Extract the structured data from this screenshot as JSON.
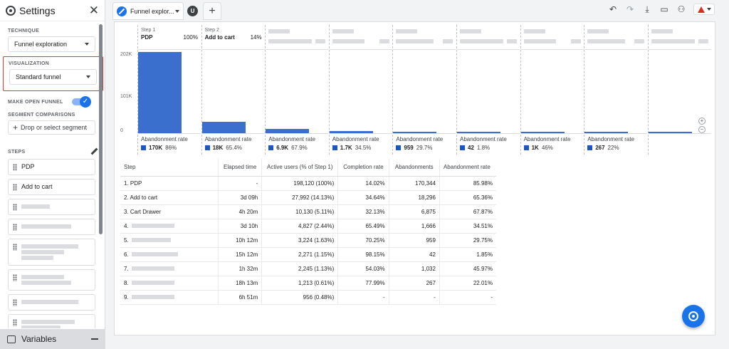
{
  "settings": {
    "title": "Settings",
    "technique_label": "TECHNIQUE",
    "technique_value": "Funnel exploration",
    "visualization_label": "VISUALIZATION",
    "visualization_value": "Standard funnel",
    "open_funnel_label": "MAKE OPEN FUNNEL",
    "open_funnel_checked": true,
    "segment_comparisons_label": "SEGMENT COMPARISONS",
    "segment_button": "Drop or select segment",
    "steps_label": "STEPS",
    "steps": [
      "PDP",
      "Add to cart"
    ],
    "variables_label": "Variables"
  },
  "tabs": {
    "active_tab": "Funnel explor...",
    "user_initial": "U",
    "add_tab": "+"
  },
  "chart": {
    "y_ticks": [
      "202K",
      "101K",
      "0"
    ],
    "columns": [
      {
        "step_num": "Step 1",
        "name": "PDP",
        "pct": "100%",
        "aband_label": "Abandonment rate",
        "aband_count": "170K",
        "aband_rate": "86%"
      },
      {
        "step_num": "Step 2",
        "name": "Add to cart",
        "pct": "14%",
        "aband_label": "Abandonment rate",
        "aband_count": "18K",
        "aband_rate": "65.4%"
      },
      {
        "step_num": "",
        "name": "",
        "pct": "",
        "aband_label": "Abandonment rate",
        "aband_count": "6.9K",
        "aband_rate": "67.9%"
      },
      {
        "step_num": "",
        "name": "",
        "pct": "",
        "aband_label": "Abandonment rate",
        "aband_count": "1.7K",
        "aband_rate": "34.5%"
      },
      {
        "step_num": "",
        "name": "",
        "pct": "",
        "aband_label": "Abandonment rate",
        "aband_count": "959",
        "aband_rate": "29.7%"
      },
      {
        "step_num": "",
        "name": "",
        "pct": "",
        "aband_label": "Abandonment rate",
        "aband_count": "42",
        "aband_rate": "1.8%"
      },
      {
        "step_num": "",
        "name": "",
        "pct": "",
        "aband_label": "Abandonment rate",
        "aband_count": "1K",
        "aband_rate": "46%"
      },
      {
        "step_num": "",
        "name": "",
        "pct": "",
        "aband_label": "Abandonment rate",
        "aband_count": "267",
        "aband_rate": "22%"
      },
      {
        "step_num": "",
        "name": "",
        "pct": "",
        "aband_label": "",
        "aband_count": "",
        "aband_rate": ""
      }
    ],
    "bar_values": [
      198120,
      27992,
      10130,
      4827,
      3224,
      2271,
      2245,
      1213,
      956
    ],
    "y_max": 202000,
    "bar_color": "#3b6fce"
  },
  "table": {
    "headers": [
      "Step",
      "Elapsed time",
      "Active users (% of Step 1)",
      "Completion rate",
      "Abandonments",
      "Abandonment rate"
    ],
    "rows": [
      [
        "1. PDP",
        "-",
        "198,120 (100%)",
        "14.02%",
        "170,344",
        "85.98%"
      ],
      [
        "2. Add to cart",
        "3d 09h",
        "27,992 (14.13%)",
        "34.64%",
        "18,296",
        "65.36%"
      ],
      [
        "3. Cart Drawer",
        "4h 20m",
        "10,130 (5.11%)",
        "32.13%",
        "6,875",
        "67.87%"
      ],
      [
        "4.",
        "3d 10h",
        "4,827 (2.44%)",
        "65.49%",
        "1,666",
        "34.51%"
      ],
      [
        "5.",
        "10h 12m",
        "3,224 (1.63%)",
        "70.25%",
        "959",
        "29.75%"
      ],
      [
        "6.",
        "15h 12m",
        "2,271 (1.15%)",
        "98.15%",
        "42",
        "1.85%"
      ],
      [
        "7.",
        "1h 32m",
        "2,245 (1.13%)",
        "54.03%",
        "1,032",
        "45.97%"
      ],
      [
        "8.",
        "18h 13m",
        "1,213 (0.61%)",
        "77.99%",
        "267",
        "22.01%"
      ],
      [
        "9.",
        "6h 51m",
        "956 (0.48%)",
        "-",
        "-",
        "-"
      ]
    ]
  }
}
